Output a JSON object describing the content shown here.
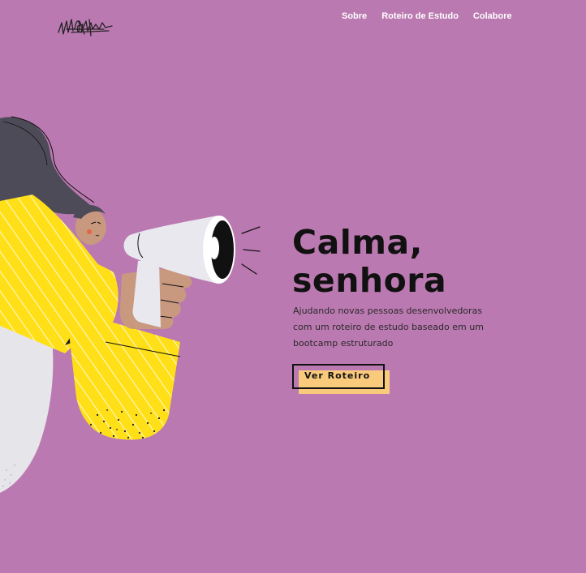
{
  "header": {
    "logo_icon": "scribble-signature-logo",
    "nav": [
      {
        "label": "Sobre"
      },
      {
        "label": "Roteiro de Estudo"
      },
      {
        "label": "Colabore"
      }
    ]
  },
  "hero": {
    "title_line1": "Calma,",
    "title_line2": "senhora",
    "subtitle": "Ajudando novas pessoas desenvolvedoras com um roteiro de estudo baseado em um bootcamp estruturado",
    "cta_label": "Ver Roteiro"
  },
  "colors": {
    "background": "#bb79b1",
    "text_dark": "#111111",
    "cta_accent": "#f9c97c",
    "illustration_yellow": "#ffe018"
  },
  "illustration": {
    "icon": "woman-with-megaphone-illustration"
  }
}
